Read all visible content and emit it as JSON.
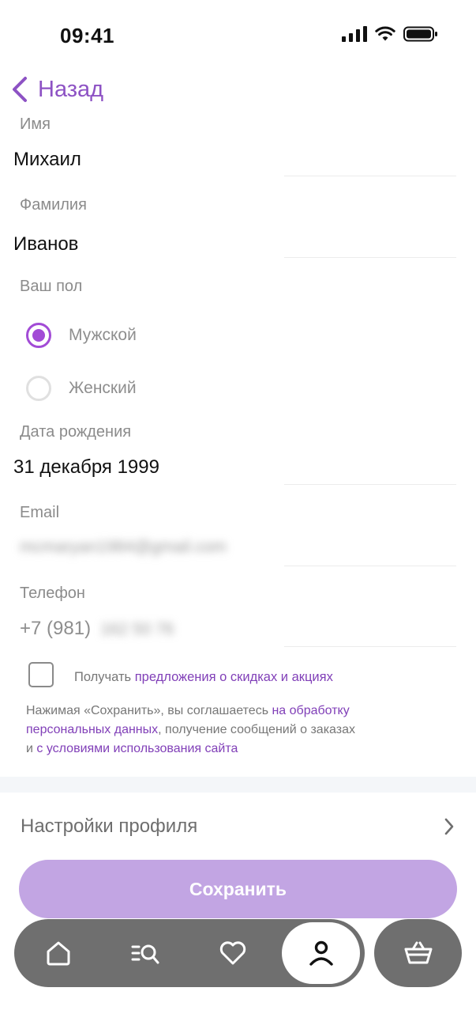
{
  "status_bar": {
    "time": "09:41"
  },
  "nav": {
    "back_label": "Назад"
  },
  "form": {
    "first_name": {
      "label": "Имя",
      "value": "Михаил"
    },
    "last_name": {
      "label": "Фамилия",
      "value": "Иванов"
    },
    "gender": {
      "label": "Ваш пол",
      "options": [
        {
          "label": "Мужской",
          "selected": true
        },
        {
          "label": "Женский",
          "selected": false
        }
      ]
    },
    "birth_date": {
      "label": "Дата рождения",
      "value": "31 декабря 1999"
    },
    "email": {
      "label": "Email",
      "value": "mcmaryan1984@gmail.com"
    },
    "phone": {
      "label": "Телефон",
      "prefix": "+7 (981)",
      "hidden_part": "162 50 76"
    }
  },
  "promo": {
    "text": "Получать ",
    "link": "предложения о скидках и акциях",
    "checked": false
  },
  "consent": {
    "part1": "Нажимая «Сохранить», вы соглашаетесь ",
    "link1a": "на обработку",
    "link1b": "персональных данных",
    "part2": ",  получение сообщений о заказах",
    "part3": "и ",
    "link2": "с условиями использования сайта"
  },
  "settings": {
    "label": "Настройки профиля"
  },
  "actions": {
    "save_label": "Сохранить"
  },
  "colors": {
    "accent": "#a24bd6",
    "link": "#8140b8",
    "save_button": "#c2a5e3",
    "tabbar": "#6f6f6f"
  },
  "tabbar": {
    "items": [
      {
        "icon": "home-icon"
      },
      {
        "icon": "catalog-search-icon"
      },
      {
        "icon": "heart-icon"
      },
      {
        "icon": "profile-icon",
        "active": true
      }
    ],
    "cart": {
      "icon": "basket-icon"
    }
  }
}
